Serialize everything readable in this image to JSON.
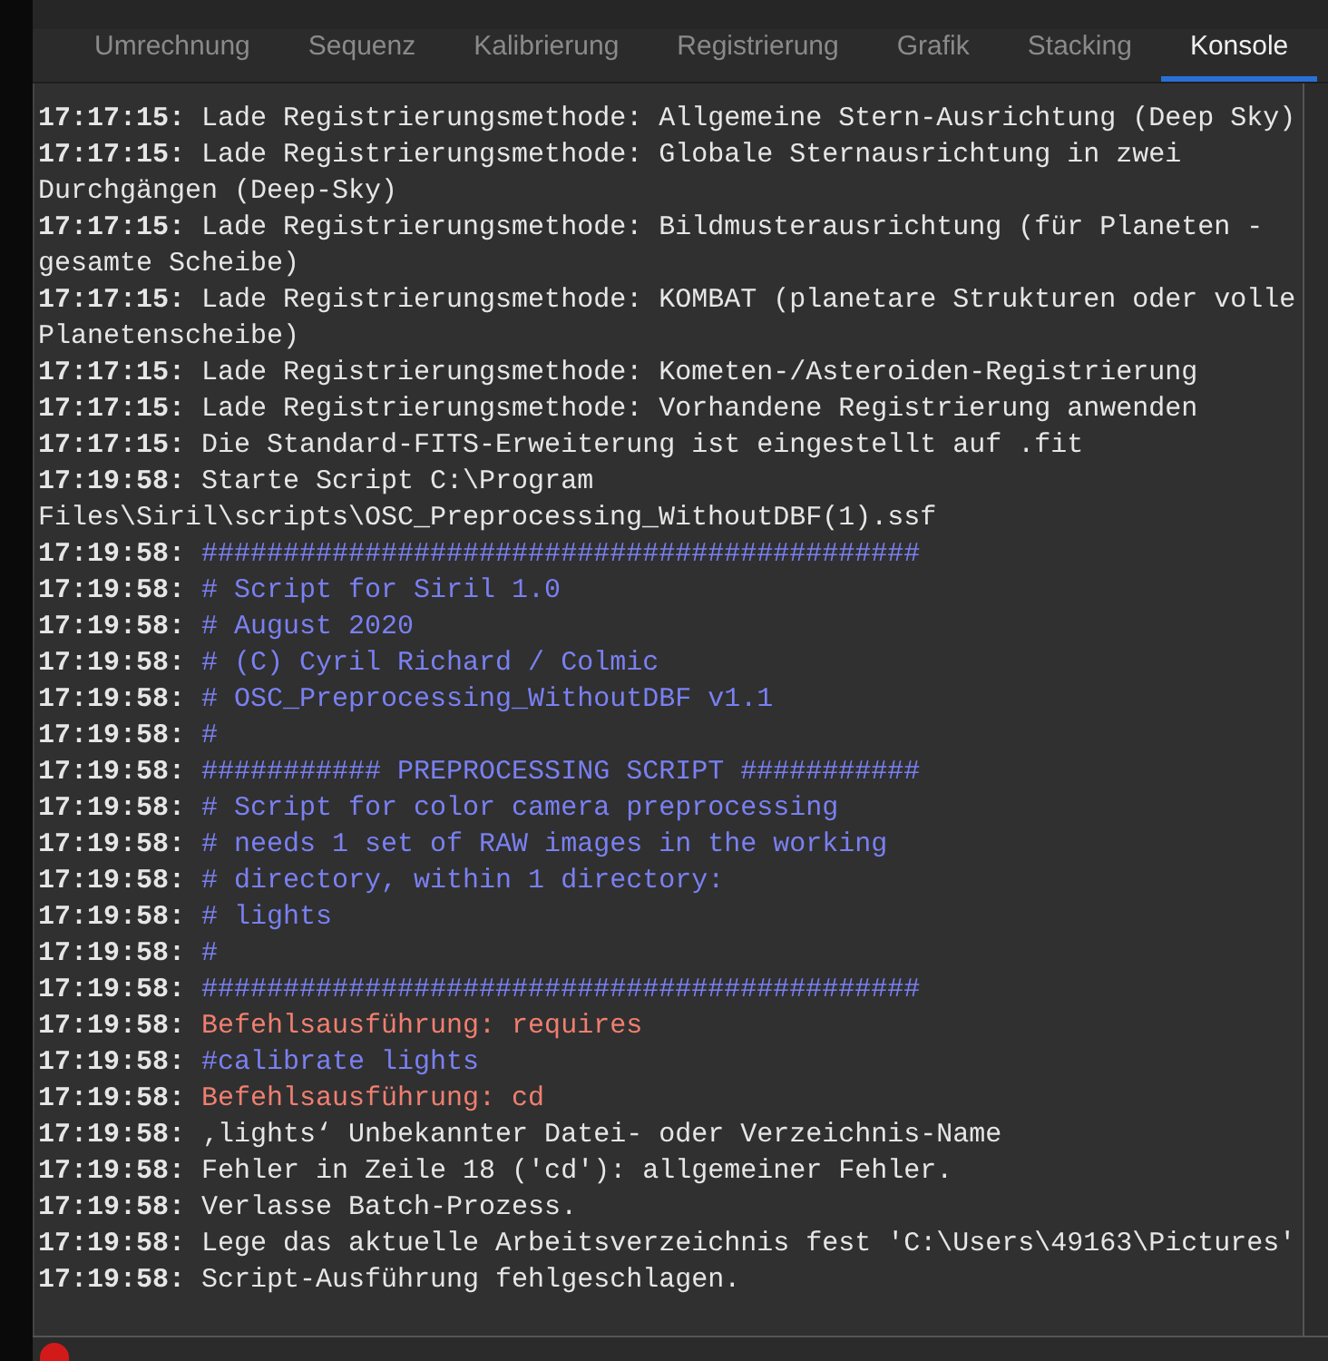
{
  "tabs": [
    {
      "label": "Umrechnung",
      "selected": false
    },
    {
      "label": "Sequenz",
      "selected": false
    },
    {
      "label": "Kalibrierung",
      "selected": false
    },
    {
      "label": "Registrierung",
      "selected": false
    },
    {
      "label": "Grafik",
      "selected": false
    },
    {
      "label": "Stacking",
      "selected": false
    },
    {
      "label": "Konsole",
      "selected": true
    }
  ],
  "console": {
    "lines": [
      {
        "time": "17:17:15:",
        "text": "Lade Registrierungsmethode: Allgemeine Stern-Ausrichtung (Deep Sky)",
        "kind": "info"
      },
      {
        "time": "17:17:15:",
        "text": "Lade Registrierungsmethode: Globale Sternausrichtung in zwei Durchgängen (Deep-Sky)",
        "kind": "info"
      },
      {
        "time": "17:17:15:",
        "text": "Lade Registrierungsmethode: Bildmusterausrichtung (für Planeten - gesamte Scheibe)",
        "kind": "info"
      },
      {
        "time": "17:17:15:",
        "text": "Lade Registrierungsmethode: KOMBAT (planetare Strukturen oder volle Planetenscheibe)",
        "kind": "info"
      },
      {
        "time": "17:17:15:",
        "text": "Lade Registrierungsmethode: Kometen-/Asteroiden-Registrierung",
        "kind": "info"
      },
      {
        "time": "17:17:15:",
        "text": "Lade Registrierungsmethode: Vorhandene Registrierung anwenden",
        "kind": "info"
      },
      {
        "time": "17:17:15:",
        "text": "Die Standard-FITS-Erweiterung ist eingestellt auf .fit",
        "kind": "info"
      },
      {
        "time": "17:19:58:",
        "text": "Starte Script C:\\Program Files\\Siril\\scripts\\OSC_Preprocessing_WithoutDBF(1).ssf",
        "kind": "info"
      },
      {
        "time": "17:19:58:",
        "text": "############################################",
        "kind": "script"
      },
      {
        "time": "17:19:58:",
        "text": "# Script for Siril 1.0",
        "kind": "script"
      },
      {
        "time": "17:19:58:",
        "text": "# August 2020",
        "kind": "script"
      },
      {
        "time": "17:19:58:",
        "text": "# (C) Cyril Richard / Colmic",
        "kind": "script"
      },
      {
        "time": "17:19:58:",
        "text": "# OSC_Preprocessing_WithoutDBF v1.1",
        "kind": "script"
      },
      {
        "time": "17:19:58:",
        "text": "#",
        "kind": "script"
      },
      {
        "time": "17:19:58:",
        "text": "########### PREPROCESSING SCRIPT ###########",
        "kind": "script"
      },
      {
        "time": "17:19:58:",
        "text": "# Script for color camera preprocessing",
        "kind": "script"
      },
      {
        "time": "17:19:58:",
        "text": "# needs 1 set of RAW images in the working",
        "kind": "script"
      },
      {
        "time": "17:19:58:",
        "text": "# directory, within 1 directory:",
        "kind": "script"
      },
      {
        "time": "17:19:58:",
        "text": "# lights",
        "kind": "script"
      },
      {
        "time": "17:19:58:",
        "text": "#",
        "kind": "script"
      },
      {
        "time": "17:19:58:",
        "text": "############################################",
        "kind": "script"
      },
      {
        "time": "17:19:58:",
        "text": "Befehlsausführung: requires",
        "kind": "error"
      },
      {
        "time": "17:19:58:",
        "text": "#calibrate lights",
        "kind": "script"
      },
      {
        "time": "17:19:58:",
        "text": "Befehlsausführung: cd",
        "kind": "error"
      },
      {
        "time": "17:19:58:",
        "text": "‚lights‘ Unbekannter Datei- oder Verzeichnis-Name",
        "kind": "info"
      },
      {
        "time": "17:19:58:",
        "text": "Fehler in Zeile 18 ('cd'): allgemeiner Fehler.",
        "kind": "info"
      },
      {
        "time": "17:19:58:",
        "text": "Verlasse Batch-Prozess.",
        "kind": "info"
      },
      {
        "time": "17:19:58:",
        "text": "Lege das aktuelle Arbeitsverzeichnis fest 'C:\\Users\\49163\\Pictures'",
        "kind": "info"
      },
      {
        "time": "17:19:58:",
        "text": "Script-Ausführung fehlgeschlagen.",
        "kind": "info"
      }
    ]
  }
}
